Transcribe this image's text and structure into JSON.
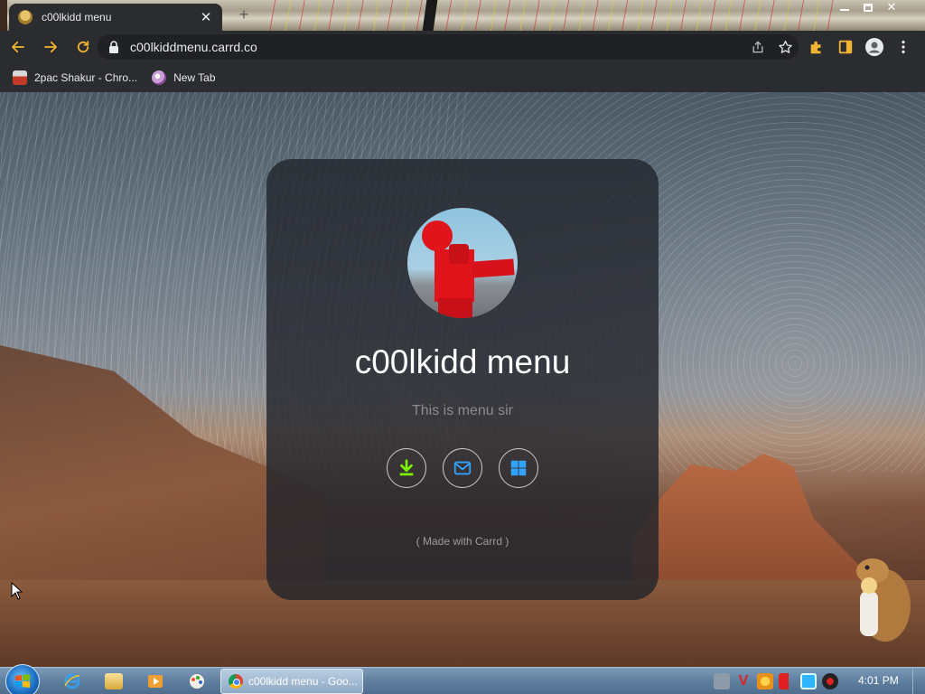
{
  "browser": {
    "tab": {
      "title": "c00lkidd menu",
      "close_label": "✕"
    },
    "new_tab_label": "+",
    "address_bar": {
      "url": "c00lkiddmenu.carrd.co"
    },
    "bookmarks": [
      {
        "label": "2pac Shakur - Chro..."
      },
      {
        "label": "New Tab"
      }
    ]
  },
  "page": {
    "title": "c00lkidd menu",
    "subtitle": "This is menu sir",
    "icon_buttons": [
      {
        "icon": "download-icon",
        "color": "#7cf000"
      },
      {
        "icon": "mail-icon",
        "color": "#2fa3ff"
      },
      {
        "icon": "windows-icon",
        "color": "#2fa3ff"
      }
    ],
    "footer": "( Made with Carrd )"
  },
  "taskbar": {
    "active_window": "c00lkidd menu - Goo...",
    "clock": "4:01 PM"
  },
  "colors": {
    "card_bg": "#23262d",
    "chrome_dark": "#2b2c2f",
    "download_green": "#7cf000",
    "accent_blue": "#2fa3ff"
  }
}
